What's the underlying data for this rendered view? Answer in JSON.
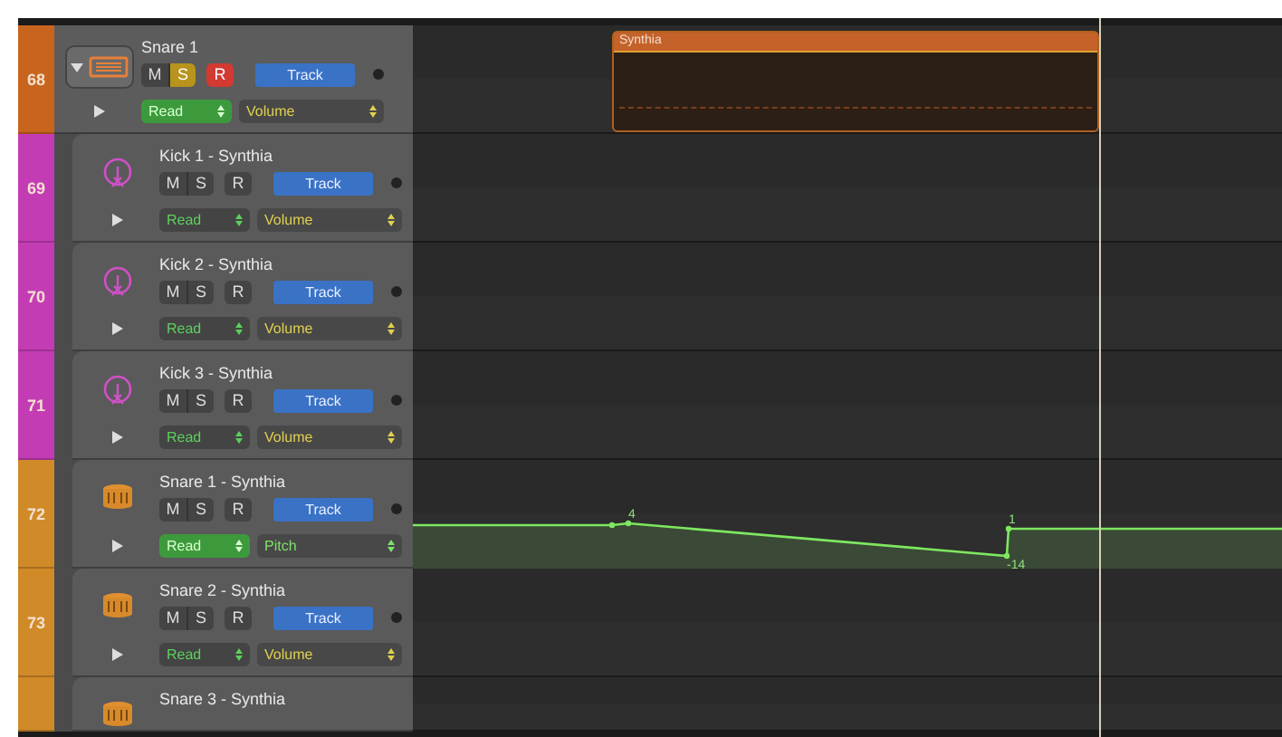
{
  "tracks": [
    {
      "number": "68",
      "color": "#c8641e",
      "kind": "folder",
      "expanded": true,
      "name": "Snare 1",
      "mute": false,
      "solo": true,
      "record": true,
      "track_button": "Track",
      "mode": "Read",
      "mode_highlighted": true,
      "parameter": "Volume",
      "labels": {
        "m": "M",
        "s": "S",
        "r": "R"
      },
      "region": {
        "name": "Synthia"
      }
    },
    {
      "number": "69",
      "color": "#c43cb4",
      "kind": "kick",
      "name": "Kick 1 - Synthia",
      "mute": false,
      "solo": false,
      "record": false,
      "track_button": "Track",
      "mode": "Read",
      "mode_highlighted": false,
      "parameter": "Volume",
      "labels": {
        "m": "M",
        "s": "S",
        "r": "R"
      }
    },
    {
      "number": "70",
      "color": "#c43cb4",
      "kind": "kick",
      "name": "Kick 2 - Synthia",
      "mute": false,
      "solo": false,
      "record": false,
      "track_button": "Track",
      "mode": "Read",
      "mode_highlighted": false,
      "parameter": "Volume",
      "labels": {
        "m": "M",
        "s": "S",
        "r": "R"
      }
    },
    {
      "number": "71",
      "color": "#c43cb4",
      "kind": "kick",
      "name": "Kick 3 - Synthia",
      "mute": false,
      "solo": false,
      "record": false,
      "track_button": "Track",
      "mode": "Read",
      "mode_highlighted": false,
      "parameter": "Volume",
      "labels": {
        "m": "M",
        "s": "S",
        "r": "R"
      }
    },
    {
      "number": "72",
      "color": "#d08a28",
      "kind": "snare",
      "name": "Snare 1 - Synthia",
      "mute": false,
      "solo": false,
      "record": false,
      "track_button": "Track",
      "mode": "Read",
      "mode_highlighted": true,
      "parameter": "Pitch",
      "labels": {
        "m": "M",
        "s": "S",
        "r": "R"
      },
      "automation": {
        "labels": [
          "4",
          "1",
          "-14"
        ]
      }
    },
    {
      "number": "73",
      "color": "#d08a28",
      "kind": "snare",
      "name": "Snare 2 - Synthia",
      "mute": false,
      "solo": false,
      "record": false,
      "track_button": "Track",
      "mode": "Read",
      "mode_highlighted": false,
      "parameter": "Volume",
      "labels": {
        "m": "M",
        "s": "S",
        "r": "R"
      }
    },
    {
      "color": "#d08a28",
      "kind": "snare",
      "name": "Snare 3 - Synthia"
    }
  ]
}
